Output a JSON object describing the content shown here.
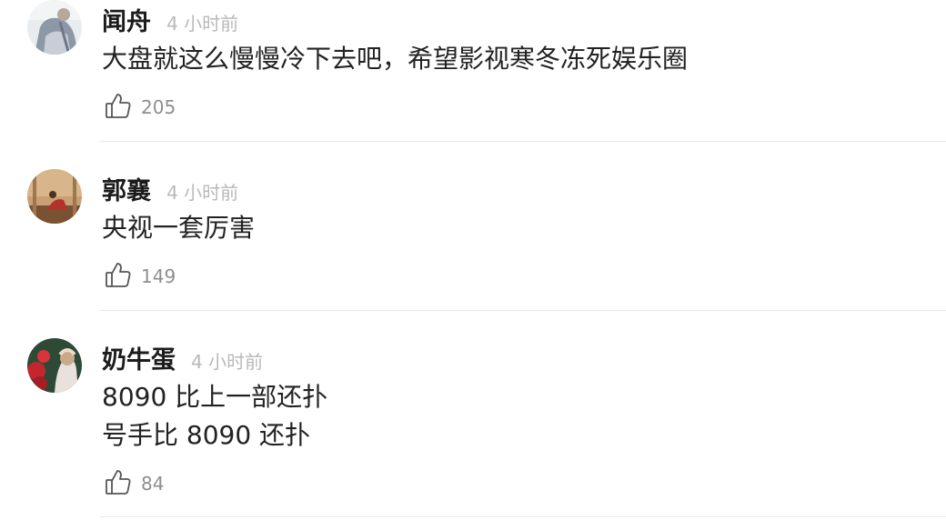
{
  "comments": [
    {
      "author": "闻舟",
      "time": "4 小时前",
      "lines": [
        "大盘就这么慢慢冷下去吧，希望影视寒冬冻死娱乐圈"
      ],
      "likes": "205"
    },
    {
      "author": "郭襄",
      "time": "4 小时前",
      "lines": [
        "央视一套厉害"
      ],
      "likes": "149"
    },
    {
      "author": "奶牛蛋",
      "time": "4 小时前",
      "lines": [
        "8090 比上一部还扑",
        "号手比 8090 还扑"
      ],
      "likes": "84"
    }
  ],
  "icons": {
    "like": "thumbs-up-icon"
  },
  "colors": {
    "author": "#1c1c1c",
    "time": "#b9b9b9",
    "like_count": "#8e8e8e",
    "divider": "#e6e6e6"
  }
}
